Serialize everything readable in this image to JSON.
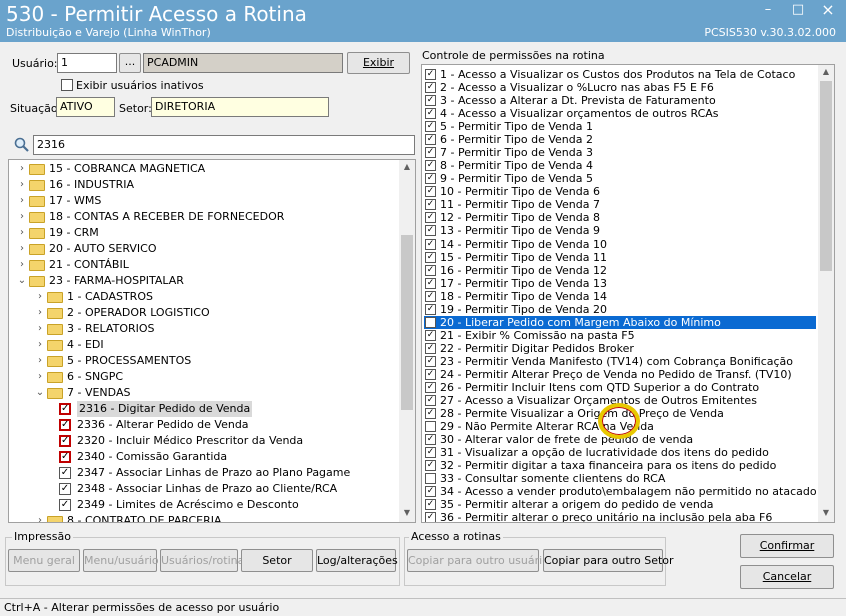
{
  "window": {
    "title": "530 - Permitir Acesso a Rotina",
    "subtitle": "Distribuição e Varejo (Linha WinThor)",
    "version": "PCSIS530  v.30.3.02.000",
    "minimize": "–",
    "maximize": "□",
    "close": "×"
  },
  "user_section": {
    "usuario_label": "Usuário:",
    "usuario_code": "1",
    "browse_label": "...",
    "usuario_name": "PCADMIN",
    "exibir_label": "Exibir",
    "inactive_checkbox_label": "Exibir usuários inativos",
    "situacao_label": "Situação:",
    "situacao_value": "ATIVO",
    "setor_label": "Setor:",
    "setor_value": "DIRETORIA"
  },
  "search": {
    "value": "2316",
    "icon": "magnifier-icon"
  },
  "tree": [
    {
      "label": "15 - COBRANCA MAGNETICA"
    },
    {
      "label": "16 - INDUSTRIA"
    },
    {
      "label": "17 - WMS"
    },
    {
      "label": "18 - CONTAS A RECEBER DE FORNECEDOR"
    },
    {
      "label": "19 - CRM"
    },
    {
      "label": "20 - AUTO SERVICO"
    },
    {
      "label": "21 - CONTÁBIL"
    },
    {
      "label": "23 - FARMA-HOSPITALAR"
    },
    {
      "label": "1 - CADASTROS"
    },
    {
      "label": "2 - OPERADOR LOGISTICO"
    },
    {
      "label": "3 - RELATORIOS"
    },
    {
      "label": "4 - EDI"
    },
    {
      "label": "5 - PROCESSAMENTOS"
    },
    {
      "label": "6 - SNGPC"
    },
    {
      "label": "7 - VENDAS"
    },
    {
      "label": "2316 - Digitar Pedido de Venda"
    },
    {
      "label": "2336 - Alterar Pedido de Venda"
    },
    {
      "label": "2320 - Incluir Médico Prescritor da Venda"
    },
    {
      "label": "2340 - Comissão Garantida"
    },
    {
      "label": "2347 - Associar Linhas de Prazo ao Plano Pagame"
    },
    {
      "label": "2348 - Associar Linhas de Prazo ao Cliente/RCA"
    },
    {
      "label": "2349 - Limites de Acréscimo e Desconto"
    },
    {
      "label": "8 - CONTRATO DE PARCERIA"
    }
  ],
  "permissions": {
    "title": "Controle de permissões na rotina",
    "items": [
      {
        "label": "1 - Acesso a Visualizar os Custos dos Produtos na Tela de Cotaco",
        "checked": true
      },
      {
        "label": "2 - Acesso a Visualizar o %Lucro nas abas F5 E F6",
        "checked": true
      },
      {
        "label": "3 - Acesso a Alterar a Dt. Prevista de Faturamento",
        "checked": true
      },
      {
        "label": "4 - Acesso a Visualizar orçamentos de outros RCAs",
        "checked": true
      },
      {
        "label": "5 - Permitir Tipo de Venda 1",
        "checked": true
      },
      {
        "label": "6 - Permitir Tipo de Venda 2",
        "checked": true
      },
      {
        "label": "7 - Permitir Tipo de Venda 3",
        "checked": true
      },
      {
        "label": "8 - Permitir Tipo de Venda 4",
        "checked": true
      },
      {
        "label": "9 - Permitir Tipo de Venda 5",
        "checked": true
      },
      {
        "label": "10 - Permitir Tipo de Venda 6",
        "checked": true
      },
      {
        "label": "11 - Permitir Tipo de Venda 7",
        "checked": true
      },
      {
        "label": "12 - Permitir Tipo de Venda 8",
        "checked": true
      },
      {
        "label": "13 - Permitir Tipo de Venda 9",
        "checked": true
      },
      {
        "label": "14 - Permitir Tipo de Venda 10",
        "checked": true
      },
      {
        "label": "15 - Permitir Tipo de Venda 11",
        "checked": true
      },
      {
        "label": "16 - Permitir Tipo de Venda 12",
        "checked": true
      },
      {
        "label": "17 - Permitir Tipo de Venda 13",
        "checked": true
      },
      {
        "label": "18 - Permitir Tipo de Venda 14",
        "checked": true
      },
      {
        "label": "19 - Permitir Tipo de Venda 20",
        "checked": true
      },
      {
        "label": "20 - Liberar Pedido com Margem Abaixo do Mínimo",
        "checked": false
      },
      {
        "label": "21 - Exibir % Comissão na pasta F5",
        "checked": true
      },
      {
        "label": "22 - Permitir Digitar Pedidos Broker",
        "checked": true
      },
      {
        "label": "23 - Permitir Venda Manifesto (TV14) com Cobrança Bonificação",
        "checked": true
      },
      {
        "label": "24 - Permitir Alterar Preço de Venda no Pedido de Transf. (TV10)",
        "checked": true
      },
      {
        "label": "26 - Permitir Incluir Itens com QTD Superior a do Contrato",
        "checked": true
      },
      {
        "label": "27 - Acesso a Visualizar Orçamentos de Outros Emitentes",
        "checked": true
      },
      {
        "label": "28 - Permite Visualizar a Origem do Preço de Venda",
        "checked": true
      },
      {
        "label": "29 - Não Permite Alterar RCA na Venda",
        "checked": false
      },
      {
        "label": "30 - Alterar valor de frete de pedido de venda",
        "checked": true
      },
      {
        "label": "31 - Visualizar a opção de lucratividade dos itens do pedido",
        "checked": true
      },
      {
        "label": "32 - Permitir digitar a taxa financeira para os itens do pedido",
        "checked": true
      },
      {
        "label": "33 - Consultar somente clientens do RCA",
        "checked": false
      },
      {
        "label": "34 - Acesso a vender produto\\embalagem não permitido no atacado",
        "checked": true
      },
      {
        "label": "35 - Permitir alterar a origem do pedido de venda",
        "checked": true
      },
      {
        "label": "36 - Permitir alterar o preço unitário na inclusão pela aba F6",
        "checked": true
      }
    ]
  },
  "impressao": {
    "title": "Impressão",
    "menu_geral": "Menu geral",
    "menu_usuario": "Menu/usuário",
    "usuarios_rotina": "Usuários/rotina",
    "setor": "Setor",
    "log": "Log/alterações"
  },
  "acesso": {
    "title": "Acesso a rotinas",
    "copiar_usuario": "Copiar para outro usuário",
    "copiar_setor": "Copiar para outro Setor"
  },
  "actions": {
    "confirmar": "Confirmar",
    "cancelar": "Cancelar"
  },
  "status": "Ctrl+A - Alterar permissões de acesso por usuário",
  "colors": {
    "titlebar": "#6aa3cc",
    "selection": "#0a6ad2",
    "highlight_circle": "#e8c800",
    "red_checkbox": "#c00000"
  }
}
